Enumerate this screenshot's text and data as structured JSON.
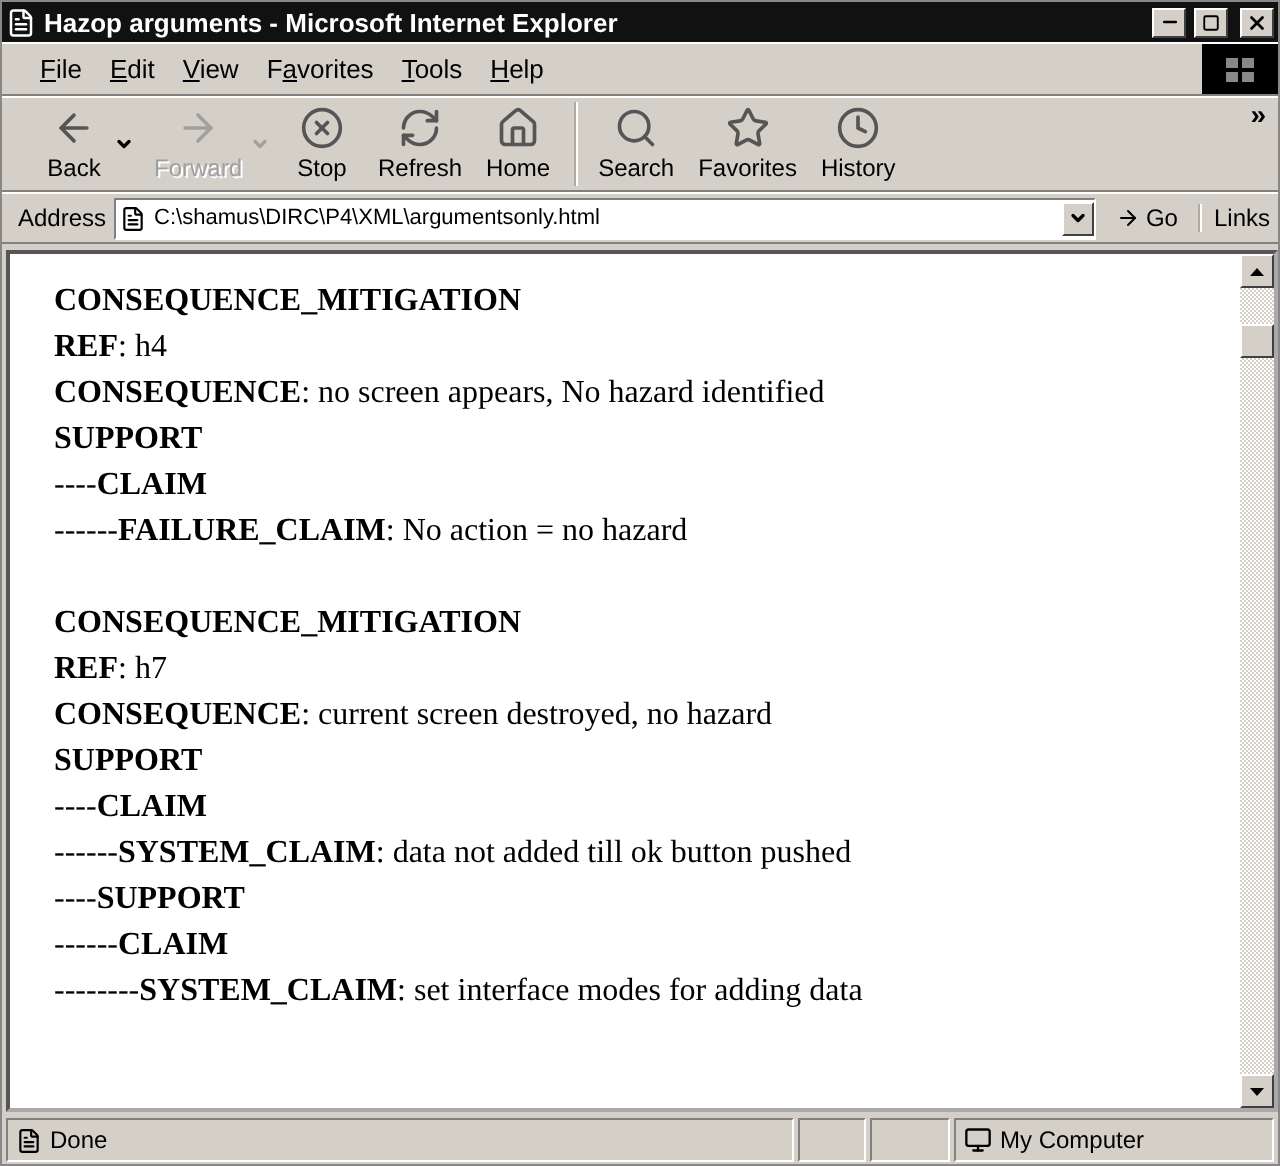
{
  "window": {
    "title": "Hazop arguments - Microsoft Internet Explorer"
  },
  "menu": [
    {
      "key": "F",
      "rest": "ile"
    },
    {
      "key": "E",
      "rest": "dit"
    },
    {
      "key": "V",
      "rest": "iew"
    },
    {
      "key": "a",
      "pre": "F",
      "rest": "vorites"
    },
    {
      "key": "T",
      "rest": "ools"
    },
    {
      "key": "H",
      "rest": "elp"
    }
  ],
  "toolbar": [
    {
      "label": "Back",
      "disabled": false,
      "dropdown": true
    },
    {
      "label": "Forward",
      "disabled": true,
      "dropdown": true
    },
    {
      "label": "Stop",
      "disabled": false
    },
    {
      "label": "Refresh",
      "disabled": false
    },
    {
      "label": "Home",
      "disabled": false,
      "separator_after": true
    },
    {
      "label": "Search",
      "disabled": false
    },
    {
      "label": "Favorites",
      "disabled": false
    },
    {
      "label": "History",
      "disabled": false
    }
  ],
  "toolbar_more": "»",
  "address": {
    "label": "Address",
    "value": "C:\\shamus\\DIRC\\P4\\XML\\argumentsonly.html",
    "go": "Go",
    "links": "Links"
  },
  "blocks": [
    {
      "lines": [
        {
          "text": "CONSEQUENCE_MITIGATION",
          "bold": true
        },
        {
          "text": "**REF**: h4",
          "bold": false
        },
        {
          "text": "**CONSEQUENCE**: no screen appears, No hazard identified",
          "bold": false
        },
        {
          "text": "SUPPORT",
          "bold": true
        },
        {
          "text": "----**CLAIM**",
          "bold": false
        },
        {
          "text": "------**FAILURE_CLAIM**: No action = no hazard",
          "bold": false
        }
      ]
    },
    {
      "lines": [
        {
          "text": "CONSEQUENCE_MITIGATION",
          "bold": true
        },
        {
          "text": "**REF**: h7",
          "bold": false
        },
        {
          "text": "**CONSEQUENCE**: current screen destroyed, no hazard",
          "bold": false
        },
        {
          "text": "SUPPORT",
          "bold": true
        },
        {
          "text": "----**CLAIM**",
          "bold": false
        },
        {
          "text": "------**SYSTEM_CLAIM**: data not added till ok button pushed",
          "bold": false
        },
        {
          "text": "----**SUPPORT**",
          "bold": false
        },
        {
          "text": "------**CLAIM**",
          "bold": false
        },
        {
          "text": "--------**SYSTEM_CLAIM**: set interface modes for adding data",
          "bold": false
        }
      ]
    }
  ],
  "status_bar": {
    "text": "Done",
    "zone": "My Computer"
  }
}
